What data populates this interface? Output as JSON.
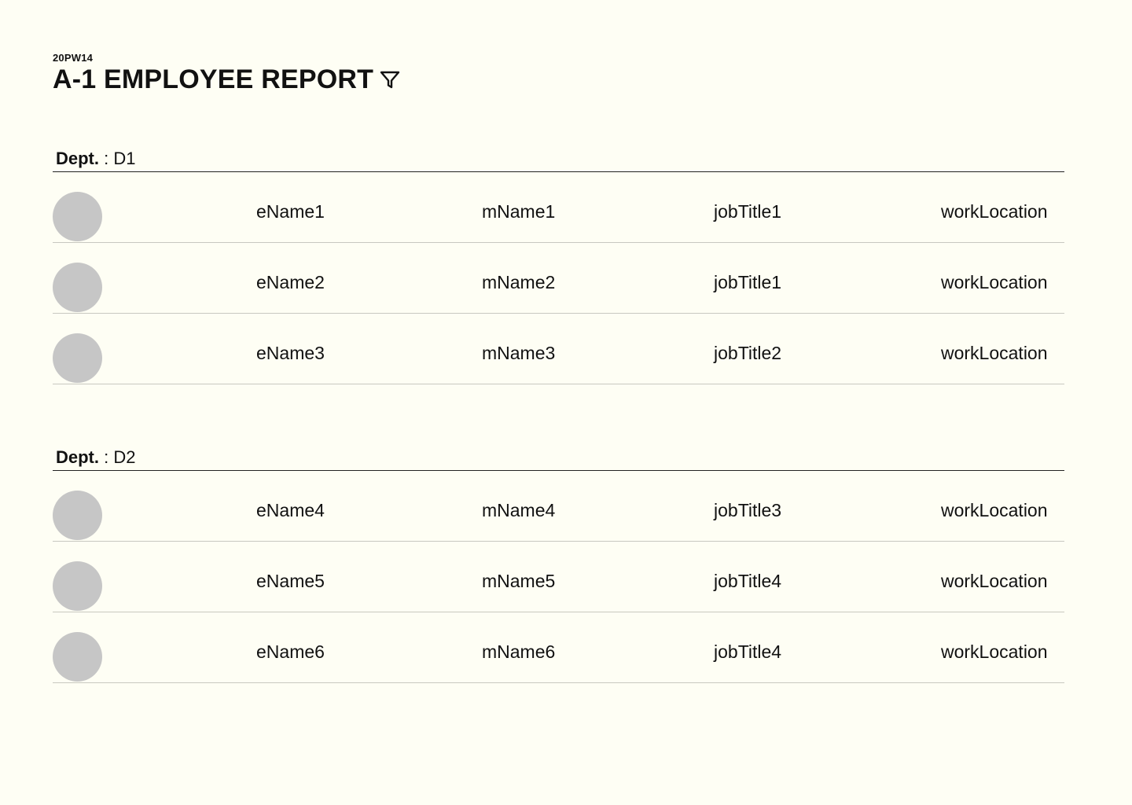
{
  "header": {
    "code": "20PW14",
    "title": "A-1 EMPLOYEE REPORT",
    "filter_icon": "filter-icon"
  },
  "departments": [
    {
      "label": "Dept.",
      "separator": " : ",
      "name": "D1",
      "employees": [
        {
          "ename": "eName1",
          "mname": "mName1",
          "job_title": "jobTitle1",
          "work_location": "workLocation"
        },
        {
          "ename": "eName2",
          "mname": "mName2",
          "job_title": "jobTitle1",
          "work_location": "workLocation"
        },
        {
          "ename": "eName3",
          "mname": "mName3",
          "job_title": "jobTitle2",
          "work_location": "workLocation"
        }
      ]
    },
    {
      "label": "Dept.",
      "separator": " : ",
      "name": "D2",
      "employees": [
        {
          "ename": "eName4",
          "mname": "mName4",
          "job_title": "jobTitle3",
          "work_location": "workLocation"
        },
        {
          "ename": "eName5",
          "mname": "mName5",
          "job_title": "jobTitle4",
          "work_location": "workLocation"
        },
        {
          "ename": "eName6",
          "mname": "mName6",
          "job_title": "jobTitle4",
          "work_location": "workLocation"
        }
      ]
    }
  ],
  "colors": {
    "background": "#fefef4",
    "avatar": "#c6c6c6",
    "row_divider": "#c8c8c0"
  }
}
